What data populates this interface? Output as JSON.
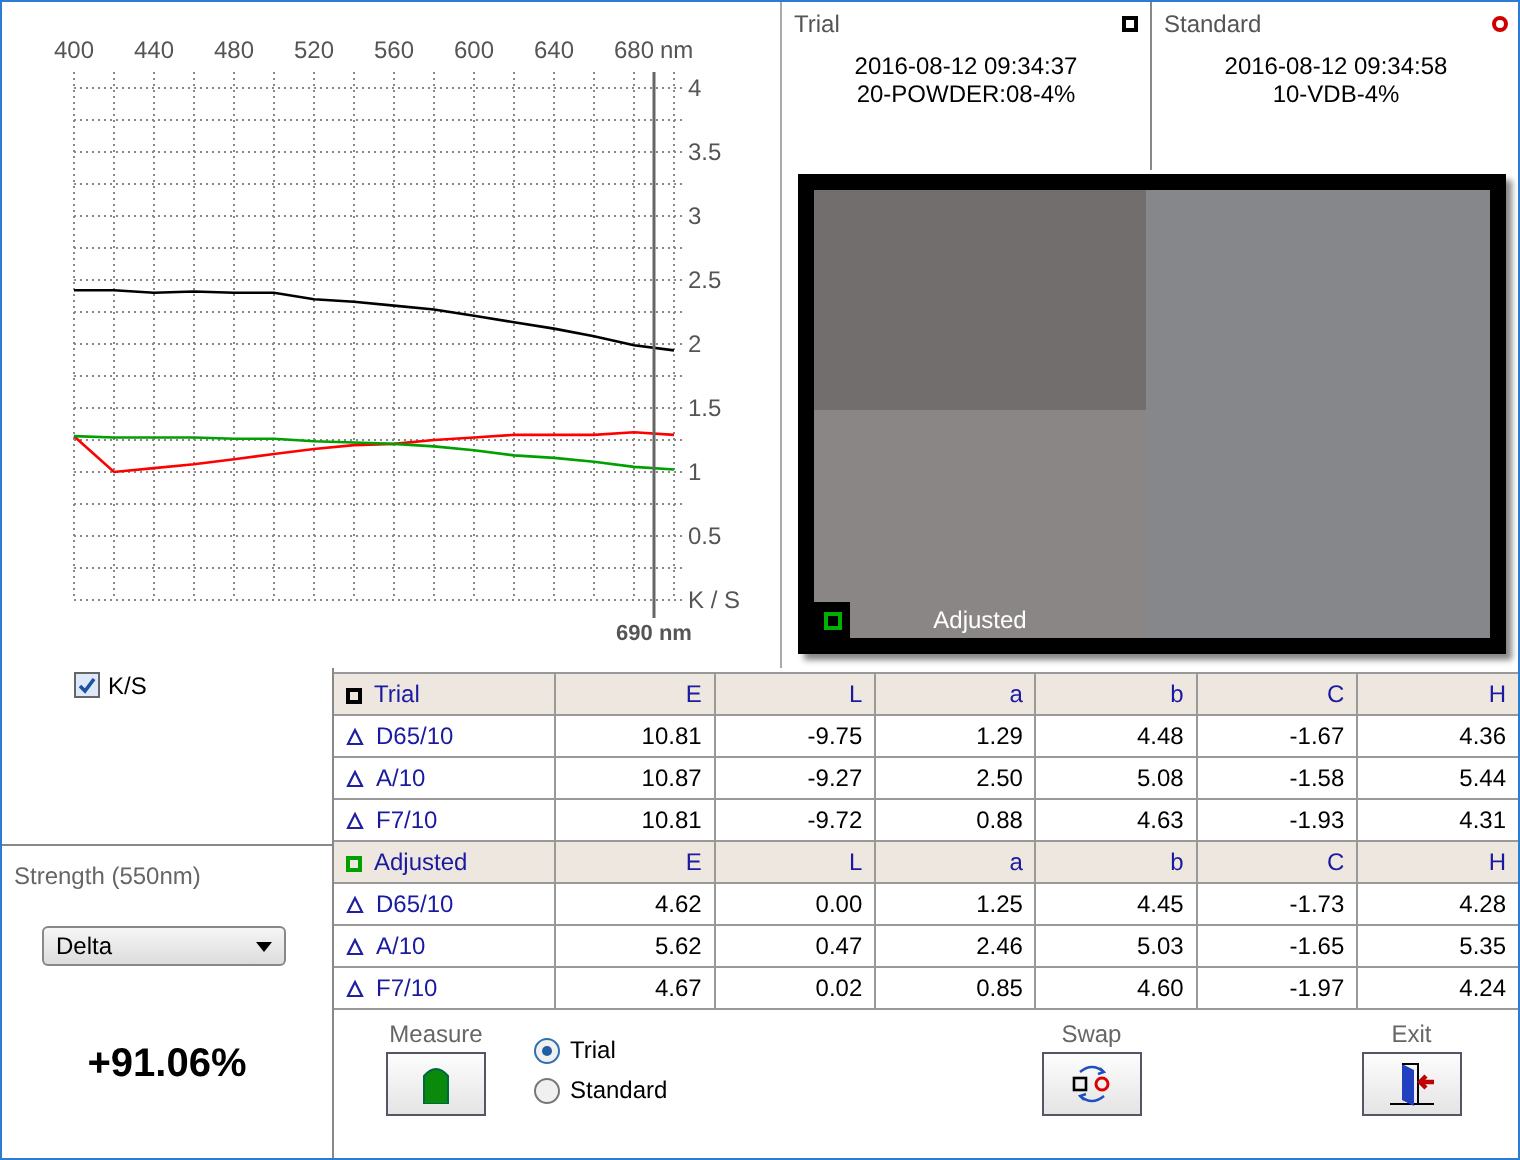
{
  "chart": {
    "chart_data": {
      "type": "line",
      "xlabel": "nm",
      "x": [
        400,
        420,
        440,
        460,
        480,
        500,
        520,
        540,
        560,
        580,
        600,
        620,
        640,
        660,
        680,
        700
      ],
      "xlim": [
        400,
        700
      ],
      "ylim": [
        0,
        4
      ],
      "xticks": [
        400,
        440,
        480,
        520,
        560,
        600,
        640,
        680
      ],
      "yticks": [
        {
          "value": 0,
          "label": "K / S"
        },
        0.5,
        1,
        1.5,
        2,
        2.5,
        3,
        3.5,
        4
      ],
      "series": [
        {
          "color": "#000000",
          "values": [
            2.42,
            2.42,
            2.4,
            2.41,
            2.4,
            2.4,
            2.35,
            2.33,
            2.3,
            2.27,
            2.22,
            2.17,
            2.12,
            2.06,
            1.99,
            1.95
          ]
        },
        {
          "color": "#ff0000",
          "values": [
            1.28,
            1.0,
            1.03,
            1.06,
            1.1,
            1.14,
            1.18,
            1.21,
            1.22,
            1.25,
            1.27,
            1.29,
            1.29,
            1.29,
            1.31,
            1.29
          ]
        },
        {
          "color": "#00a000",
          "values": [
            1.28,
            1.27,
            1.27,
            1.27,
            1.26,
            1.26,
            1.24,
            1.23,
            1.22,
            1.2,
            1.17,
            1.13,
            1.11,
            1.08,
            1.04,
            1.02
          ]
        }
      ],
      "grid": true,
      "ref_lines": [
        {
          "axis": "x",
          "value": 690,
          "label": "690 nm"
        }
      ]
    }
  },
  "ks_checkbox": {
    "label": "K/S",
    "checked": true
  },
  "samples": [
    {
      "label": "Trial",
      "kind": "square",
      "color": "#000000",
      "time": "2016-08-12 09:34:37",
      "name": "20-POWDER:08-4%"
    },
    {
      "label": "Standard",
      "kind": "circle",
      "color": "#d00000",
      "time": "2016-08-12 09:34:58",
      "name": "10-VDB-4%"
    }
  ],
  "preview": {
    "label": "Adjusted"
  },
  "strength": {
    "title": "Strength (550nm)",
    "mode": "Delta",
    "value": "+91.06%"
  },
  "table": {
    "groups": [
      {
        "label": "Trial",
        "color": "#000000",
        "columns": [
          "E",
          "L",
          "a",
          "b",
          "C",
          "H"
        ],
        "rows": [
          {
            "illuminant": "D65/10",
            "values": [
              "10.81",
              "-9.75",
              "1.29",
              "4.48",
              "-1.67",
              "4.36"
            ]
          },
          {
            "illuminant": "A/10",
            "values": [
              "10.87",
              "-9.27",
              "2.50",
              "5.08",
              "-1.58",
              "5.44"
            ]
          },
          {
            "illuminant": "F7/10",
            "values": [
              "10.81",
              "-9.72",
              "0.88",
              "4.63",
              "-1.93",
              "4.31"
            ]
          }
        ]
      },
      {
        "label": "Adjusted",
        "color": "#00a000",
        "columns": [
          "E",
          "L",
          "a",
          "b",
          "C",
          "H"
        ],
        "rows": [
          {
            "illuminant": "D65/10",
            "values": [
              "4.62",
              "0.00",
              "1.25",
              "4.45",
              "-1.73",
              "4.28"
            ]
          },
          {
            "illuminant": "A/10",
            "values": [
              "5.62",
              "0.47",
              "2.46",
              "5.03",
              "-1.65",
              "5.35"
            ]
          },
          {
            "illuminant": "F7/10",
            "values": [
              "4.67",
              "0.02",
              "0.85",
              "4.60",
              "-1.97",
              "4.24"
            ]
          }
        ]
      }
    ]
  },
  "measure": {
    "label": "Measure"
  },
  "radios": [
    {
      "label": "Trial",
      "selected": true
    },
    {
      "label": "Standard",
      "selected": false
    }
  ],
  "swap": {
    "label": "Swap"
  },
  "exit": {
    "label": "Exit"
  }
}
